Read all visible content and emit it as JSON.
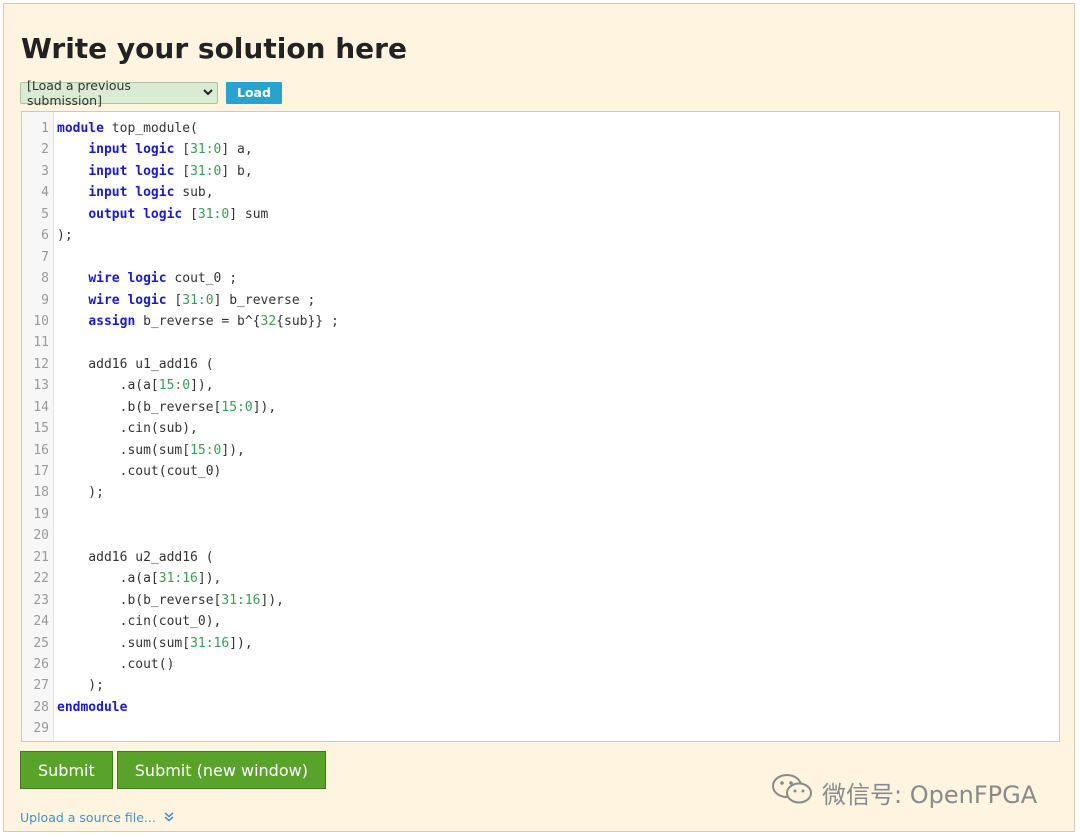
{
  "page": {
    "title": "Write your solution here"
  },
  "toolbar": {
    "select_value": "[Load a previous submission]",
    "load_label": "Load"
  },
  "editor": {
    "lines": [
      {
        "n": "1",
        "tokens": [
          [
            "kw",
            "module"
          ],
          [
            "t",
            " top_module("
          ]
        ]
      },
      {
        "n": "2",
        "tokens": [
          [
            "t",
            "    "
          ],
          [
            "kw",
            "input"
          ],
          [
            "t",
            " "
          ],
          [
            "kw",
            "logic"
          ],
          [
            "t",
            " ["
          ],
          [
            "num",
            "31:0"
          ],
          [
            "t",
            "] a,"
          ]
        ]
      },
      {
        "n": "3",
        "tokens": [
          [
            "t",
            "    "
          ],
          [
            "kw",
            "input"
          ],
          [
            "t",
            " "
          ],
          [
            "kw",
            "logic"
          ],
          [
            "t",
            " ["
          ],
          [
            "num",
            "31:0"
          ],
          [
            "t",
            "] b,"
          ]
        ]
      },
      {
        "n": "4",
        "tokens": [
          [
            "t",
            "    "
          ],
          [
            "kw",
            "input"
          ],
          [
            "t",
            " "
          ],
          [
            "kw",
            "logic"
          ],
          [
            "t",
            " sub,"
          ]
        ]
      },
      {
        "n": "5",
        "tokens": [
          [
            "t",
            "    "
          ],
          [
            "kw",
            "output"
          ],
          [
            "t",
            " "
          ],
          [
            "kw",
            "logic"
          ],
          [
            "t",
            " ["
          ],
          [
            "num",
            "31:0"
          ],
          [
            "t",
            "] sum"
          ]
        ]
      },
      {
        "n": "6",
        "tokens": [
          [
            "t",
            ");"
          ]
        ]
      },
      {
        "n": "7",
        "tokens": []
      },
      {
        "n": "8",
        "tokens": [
          [
            "t",
            "    "
          ],
          [
            "kw",
            "wire"
          ],
          [
            "t",
            " "
          ],
          [
            "kw",
            "logic"
          ],
          [
            "t",
            " cout_0 ;"
          ]
        ]
      },
      {
        "n": "9",
        "tokens": [
          [
            "t",
            "    "
          ],
          [
            "kw",
            "wire"
          ],
          [
            "t",
            " "
          ],
          [
            "kw",
            "logic"
          ],
          [
            "t",
            " ["
          ],
          [
            "num",
            "31:0"
          ],
          [
            "t",
            "] b_reverse ;"
          ]
        ]
      },
      {
        "n": "10",
        "tokens": [
          [
            "t",
            "    "
          ],
          [
            "kw",
            "assign"
          ],
          [
            "t",
            " b_reverse = b^{"
          ],
          [
            "num",
            "32"
          ],
          [
            "t",
            "{sub}} ;"
          ]
        ]
      },
      {
        "n": "11",
        "tokens": []
      },
      {
        "n": "12",
        "tokens": [
          [
            "t",
            "    add16 u1_add16 ("
          ]
        ]
      },
      {
        "n": "13",
        "tokens": [
          [
            "t",
            "        .a(a["
          ],
          [
            "num",
            "15:0"
          ],
          [
            "t",
            "]),"
          ]
        ]
      },
      {
        "n": "14",
        "tokens": [
          [
            "t",
            "        .b(b_reverse["
          ],
          [
            "num",
            "15:0"
          ],
          [
            "t",
            "]),"
          ]
        ]
      },
      {
        "n": "15",
        "tokens": [
          [
            "t",
            "        .cin(sub),"
          ]
        ]
      },
      {
        "n": "16",
        "tokens": [
          [
            "t",
            "        .sum(sum["
          ],
          [
            "num",
            "15:0"
          ],
          [
            "t",
            "]),"
          ]
        ]
      },
      {
        "n": "17",
        "tokens": [
          [
            "t",
            "        .cout(cout_0)"
          ]
        ]
      },
      {
        "n": "18",
        "tokens": [
          [
            "t",
            "    );"
          ]
        ]
      },
      {
        "n": "19",
        "tokens": []
      },
      {
        "n": "20",
        "tokens": []
      },
      {
        "n": "21",
        "tokens": [
          [
            "t",
            "    add16 u2_add16 ("
          ]
        ]
      },
      {
        "n": "22",
        "tokens": [
          [
            "t",
            "        .a(a["
          ],
          [
            "num",
            "31:16"
          ],
          [
            "t",
            "]),"
          ]
        ]
      },
      {
        "n": "23",
        "tokens": [
          [
            "t",
            "        .b(b_reverse["
          ],
          [
            "num",
            "31:16"
          ],
          [
            "t",
            "]),"
          ]
        ]
      },
      {
        "n": "24",
        "tokens": [
          [
            "t",
            "        .cin(cout_0),"
          ]
        ]
      },
      {
        "n": "25",
        "tokens": [
          [
            "t",
            "        .sum(sum["
          ],
          [
            "num",
            "31:16"
          ],
          [
            "t",
            "]),"
          ]
        ]
      },
      {
        "n": "26",
        "tokens": [
          [
            "t",
            "        .cout()"
          ]
        ]
      },
      {
        "n": "27",
        "tokens": [
          [
            "t",
            "    );"
          ]
        ]
      },
      {
        "n": "28",
        "tokens": [
          [
            "kw",
            "endmodule"
          ]
        ]
      },
      {
        "n": "29",
        "tokens": []
      }
    ]
  },
  "actions": {
    "submit_label": "Submit",
    "submit_new_window_label": "Submit (new window)",
    "upload_label": "Upload a source file..."
  },
  "watermark": {
    "text": "微信号: OpenFPGA"
  },
  "colors": {
    "keyword": "#1a1acc",
    "number": "#3b9b55",
    "submit": "#5aa32a",
    "load": "#2aa3cc"
  }
}
